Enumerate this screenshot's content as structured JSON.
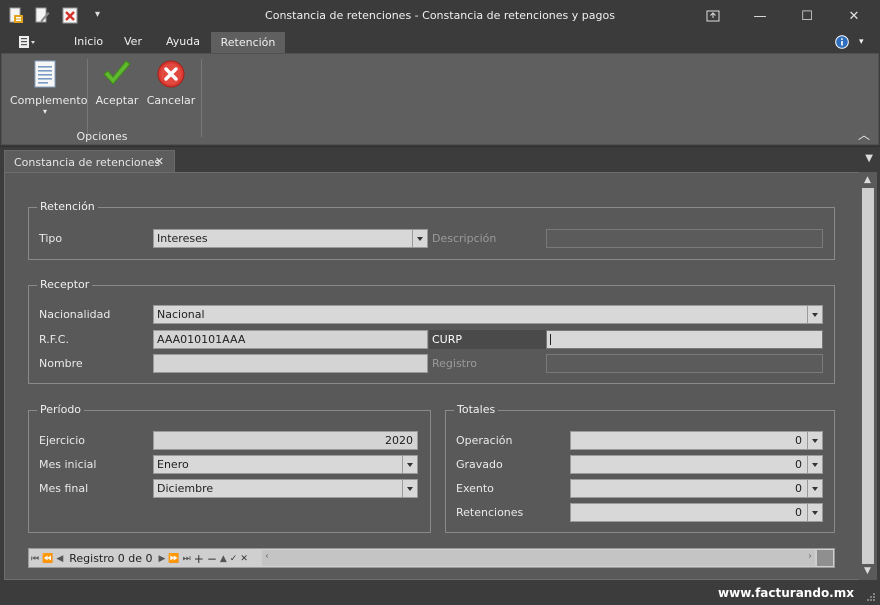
{
  "window": {
    "title": "Constancia de retenciones - Constancia de retenciones y pagos",
    "controls": {
      "minimize": "—",
      "maximize": "☐",
      "close": "✕",
      "restore_panel": "⇱"
    }
  },
  "quick_access": {
    "dropdown": "▾"
  },
  "menu": {
    "tabs": [
      "Inicio",
      "Ver",
      "Ayuda",
      "Retención"
    ],
    "active": "Retención"
  },
  "ribbon": {
    "buttons": {
      "complemento": "Complemento",
      "aceptar": "Aceptar",
      "cancelar": "Cancelar"
    },
    "group_label": "Opciones",
    "collapse": "︿"
  },
  "doc_tabs": [
    {
      "label": "Constancia de retenciones",
      "close": "✕"
    }
  ],
  "form": {
    "retencion": {
      "legend": "Retención",
      "tipo_label": "Tipo",
      "tipo_value": "Intereses",
      "descripcion_label": "Descripción",
      "descripcion_value": ""
    },
    "receptor": {
      "legend": "Receptor",
      "nacionalidad_label": "Nacionalidad",
      "nacionalidad_value": "Nacional",
      "rfc_label": "R.F.C.",
      "rfc_value": "AAA010101AAA",
      "curp_label": "CURP",
      "curp_value": "",
      "nombre_label": "Nombre",
      "nombre_value": "",
      "registro_label": "Registro",
      "registro_value": ""
    },
    "periodo": {
      "legend": "Período",
      "ejercicio_label": "Ejercicio",
      "ejercicio_value": "2020",
      "mes_inicial_label": "Mes inicial",
      "mes_inicial_value": "Enero",
      "mes_final_label": "Mes final",
      "mes_final_value": "Diciembre"
    },
    "totales": {
      "legend": "Totales",
      "operacion_label": "Operación",
      "operacion_value": "0",
      "gravado_label": "Gravado",
      "gravado_value": "0",
      "exento_label": "Exento",
      "exento_value": "0",
      "retenciones_label": "Retenciones",
      "retenciones_value": "0"
    }
  },
  "navigator": {
    "record_text": "Registro 0 de 0",
    "buttons": [
      "⏮",
      "⏪",
      "◀",
      "▶",
      "⏩",
      "⏭",
      "+",
      "−",
      "▲",
      "✓",
      "✕"
    ]
  },
  "status": {
    "brand": "www.facturando.mx"
  },
  "colors": {
    "accent_check": "#5fb82e",
    "cancel_red": "#d93a32",
    "info_blue": "#2f6ebd"
  }
}
